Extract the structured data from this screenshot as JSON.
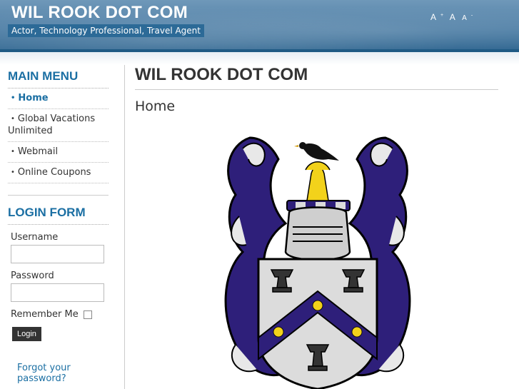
{
  "header": {
    "site_title": "WIL ROOK DOT COM",
    "tagline": "Actor, Technology Professional, Travel Agent",
    "font_sizer": {
      "increase": "A",
      "reset": "A",
      "decrease": "A",
      "increase_sup": "+",
      "decrease_sup": "-"
    }
  },
  "sidebar": {
    "main_menu_title": "MAIN MENU",
    "menu_items": [
      {
        "label": "Home",
        "active": true
      },
      {
        "label": "Global Vacations Unlimited"
      },
      {
        "label": "Webmail"
      },
      {
        "label": "Online Coupons"
      }
    ],
    "login": {
      "title": "LOGIN FORM",
      "username_label": "Username",
      "password_label": "Password",
      "remember_label": "Remember Me",
      "button": "Login",
      "forgot": "Forgot your password?"
    }
  },
  "main": {
    "page_title": "WIL ROOK DOT COM",
    "article_title": "Home"
  },
  "colors": {
    "header": "#4f7fa6",
    "accent": "#1b6fa3",
    "crest_blue": "#2e1f7a",
    "crest_gold": "#f2d21b"
  }
}
